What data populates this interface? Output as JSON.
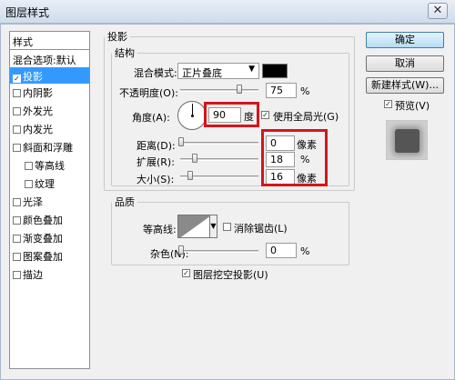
{
  "window": {
    "title": "图层样式",
    "close_glyph": "✕"
  },
  "sidebar": {
    "header": "样式",
    "items": [
      {
        "label": "混合选项:默认",
        "checkbox": false,
        "checked": false,
        "selected": false
      },
      {
        "label": "投影",
        "checkbox": true,
        "checked": true,
        "selected": true
      },
      {
        "label": "内阴影",
        "checkbox": true,
        "checked": false,
        "selected": false
      },
      {
        "label": "外发光",
        "checkbox": true,
        "checked": false,
        "selected": false
      },
      {
        "label": "内发光",
        "checkbox": true,
        "checked": false,
        "selected": false
      },
      {
        "label": "斜面和浮雕",
        "checkbox": true,
        "checked": false,
        "selected": false
      },
      {
        "label": "等高线",
        "checkbox": true,
        "checked": false,
        "selected": false
      },
      {
        "label": "纹理",
        "checkbox": true,
        "checked": false,
        "selected": false
      },
      {
        "label": "光泽",
        "checkbox": true,
        "checked": false,
        "selected": false
      },
      {
        "label": "颜色叠加",
        "checkbox": true,
        "checked": false,
        "selected": false
      },
      {
        "label": "渐变叠加",
        "checkbox": true,
        "checked": false,
        "selected": false
      },
      {
        "label": "图案叠加",
        "checkbox": true,
        "checked": false,
        "selected": false
      },
      {
        "label": "描边",
        "checkbox": true,
        "checked": false,
        "selected": false
      }
    ]
  },
  "shadow": {
    "group_label": "投影",
    "structure_label": "结构",
    "blend_mode_label": "混合模式:",
    "blend_mode_value": "正片叠底",
    "blend_color": "#000000",
    "opacity_label": "不透明度(O):",
    "opacity_value": "75",
    "opacity_unit": "%",
    "angle_label": "角度(A):",
    "angle_value": "90",
    "angle_unit": "度",
    "global_light_label": "使用全局光(G)",
    "global_light_checked": true,
    "distance_label": "距离(D):",
    "distance_value": "0",
    "distance_unit": "像素",
    "spread_label": "扩展(R):",
    "spread_value": "18",
    "spread_unit": "%",
    "size_label": "大小(S):",
    "size_value": "16",
    "size_unit": "像素"
  },
  "quality": {
    "group_label": "品质",
    "contour_label": "等高线:",
    "antialias_label": "消除锯齿(L)",
    "antialias_checked": false,
    "noise_label": "杂色(N):",
    "noise_value": "0",
    "noise_unit": "%",
    "knockout_label": "图层挖空投影(U)",
    "knockout_checked": true
  },
  "buttons": {
    "ok": "确定",
    "cancel": "取消",
    "new_style": "新建样式(W)...",
    "preview_label": "预览(V)",
    "preview_checked": true
  },
  "check_glyph": "✓",
  "dropdown_glyph": "▼"
}
